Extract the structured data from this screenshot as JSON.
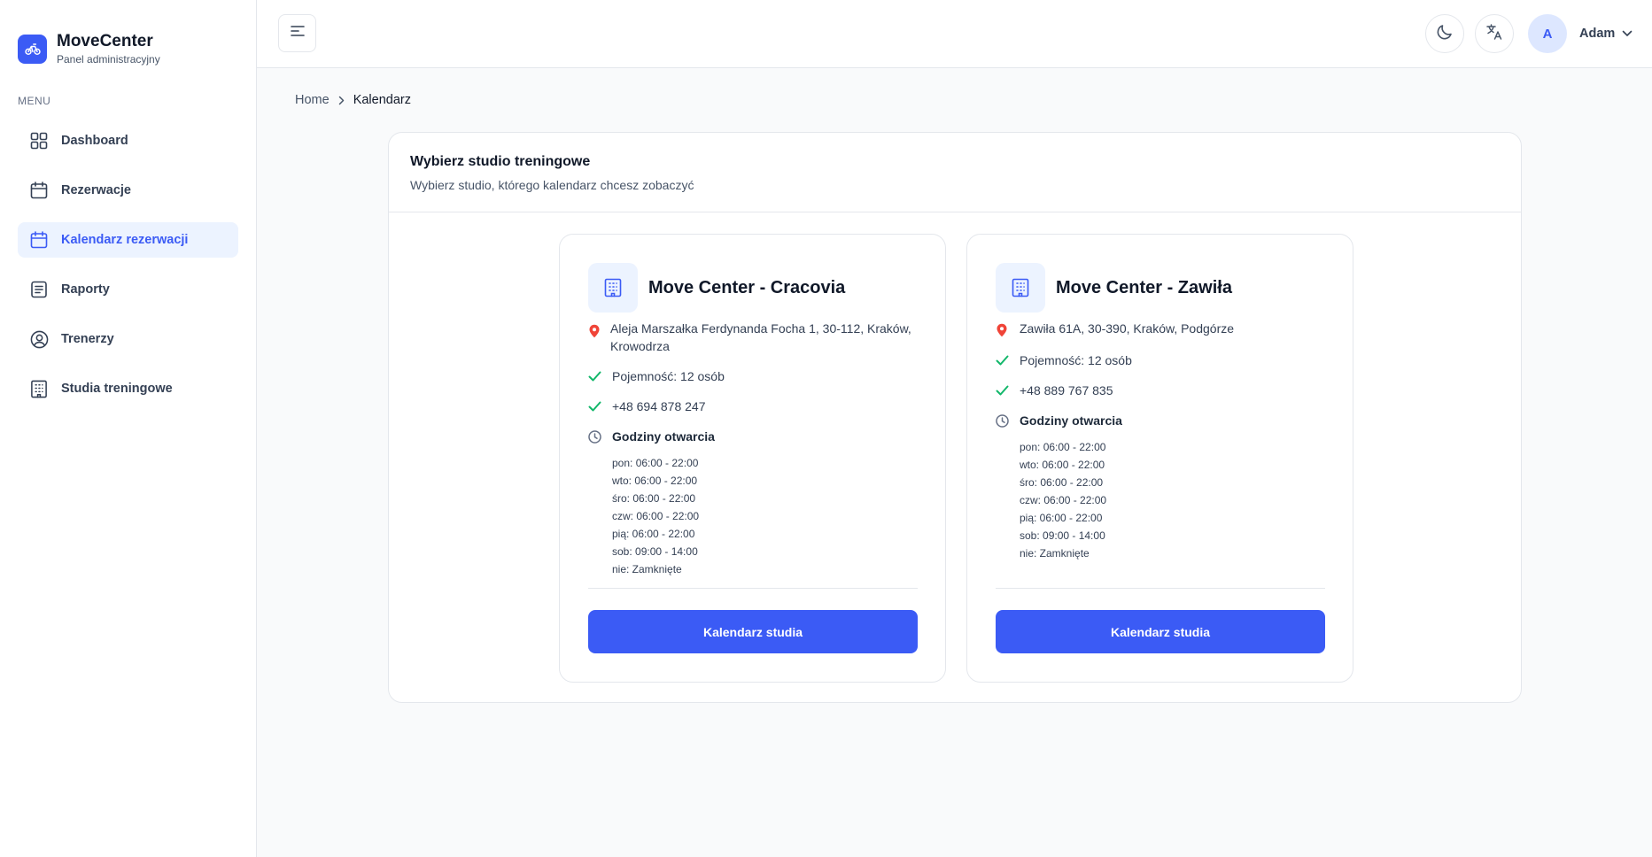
{
  "brand": {
    "title": "MoveCenter",
    "subtitle": "Panel administracyjny",
    "accent": "#3b5bf5"
  },
  "sidebar": {
    "menu_label": "MENU",
    "items": [
      {
        "label": "Dashboard",
        "icon": "grid-icon",
        "active": false
      },
      {
        "label": "Rezerwacje",
        "icon": "calendar-icon",
        "active": false
      },
      {
        "label": "Kalendarz rezerwacji",
        "icon": "calendar-icon",
        "active": true
      },
      {
        "label": "Raporty",
        "icon": "report-icon",
        "active": false
      },
      {
        "label": "Trenerzy",
        "icon": "user-circle-icon",
        "active": false
      },
      {
        "label": "Studia treningowe",
        "icon": "building-icon",
        "active": false
      }
    ]
  },
  "header": {
    "user": {
      "initial": "A",
      "name": "Adam"
    }
  },
  "breadcrumb": {
    "home": "Home",
    "current": "Kalendarz"
  },
  "main": {
    "title": "Wybierz studio treningowe",
    "subtitle": "Wybierz studio, którego kalendarz chcesz zobaczyć"
  },
  "studios": [
    {
      "name": "Move Center - Cracovia",
      "address": "Aleja Marszałka Ferdynanda Focha 1, 30-112, Kraków, Krowodrza",
      "capacity": "Pojemność: 12 osób",
      "phone": "+48 694 878 247",
      "hours_title": "Godziny otwarcia",
      "hours": [
        "pon: 06:00 - 22:00",
        "wto: 06:00 - 22:00",
        "śro: 06:00 - 22:00",
        "czw: 06:00 - 22:00",
        "pią: 06:00 - 22:00",
        "sob: 09:00 - 14:00",
        "nie: Zamknięte"
      ],
      "button": "Kalendarz studia"
    },
    {
      "name": "Move Center - Zawiła",
      "address": "Zawiła 61A, 30-390, Kraków, Podgórze",
      "capacity": "Pojemność: 12 osób",
      "phone": "+48 889 767 835",
      "hours_title": "Godziny otwarcia",
      "hours": [
        "pon: 06:00 - 22:00",
        "wto: 06:00 - 22:00",
        "śro: 06:00 - 22:00",
        "czw: 06:00 - 22:00",
        "pią: 06:00 - 22:00",
        "sob: 09:00 - 14:00",
        "nie: Zamknięte"
      ],
      "button": "Kalendarz studia"
    }
  ],
  "colors": {
    "check": "#12b76a",
    "pin": "#f04438",
    "button": "#3b5bf5"
  }
}
